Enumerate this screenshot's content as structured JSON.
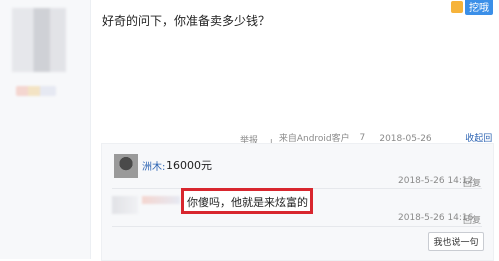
{
  "post": {
    "text": "好奇的问下，你准备卖多少钱？",
    "meta": {
      "report": "举报",
      "report_arrow": "▾",
      "sep": "|",
      "source": "来自Android客户端",
      "floor": "7楼",
      "time": "2018-05-26 14:08",
      "collapse": "收起回复"
    }
  },
  "header_badge": {
    "label": "挖哦"
  },
  "comments": [
    {
      "name": "洲木:",
      "text": "16000元",
      "time": "2018-5-26 14:12",
      "reply": "回复"
    },
    {
      "text": "你傻吗，他就是来炫富的",
      "time": "2018-5-26 14:16",
      "reply": "回复"
    }
  ],
  "reply_button": "我也说一句"
}
